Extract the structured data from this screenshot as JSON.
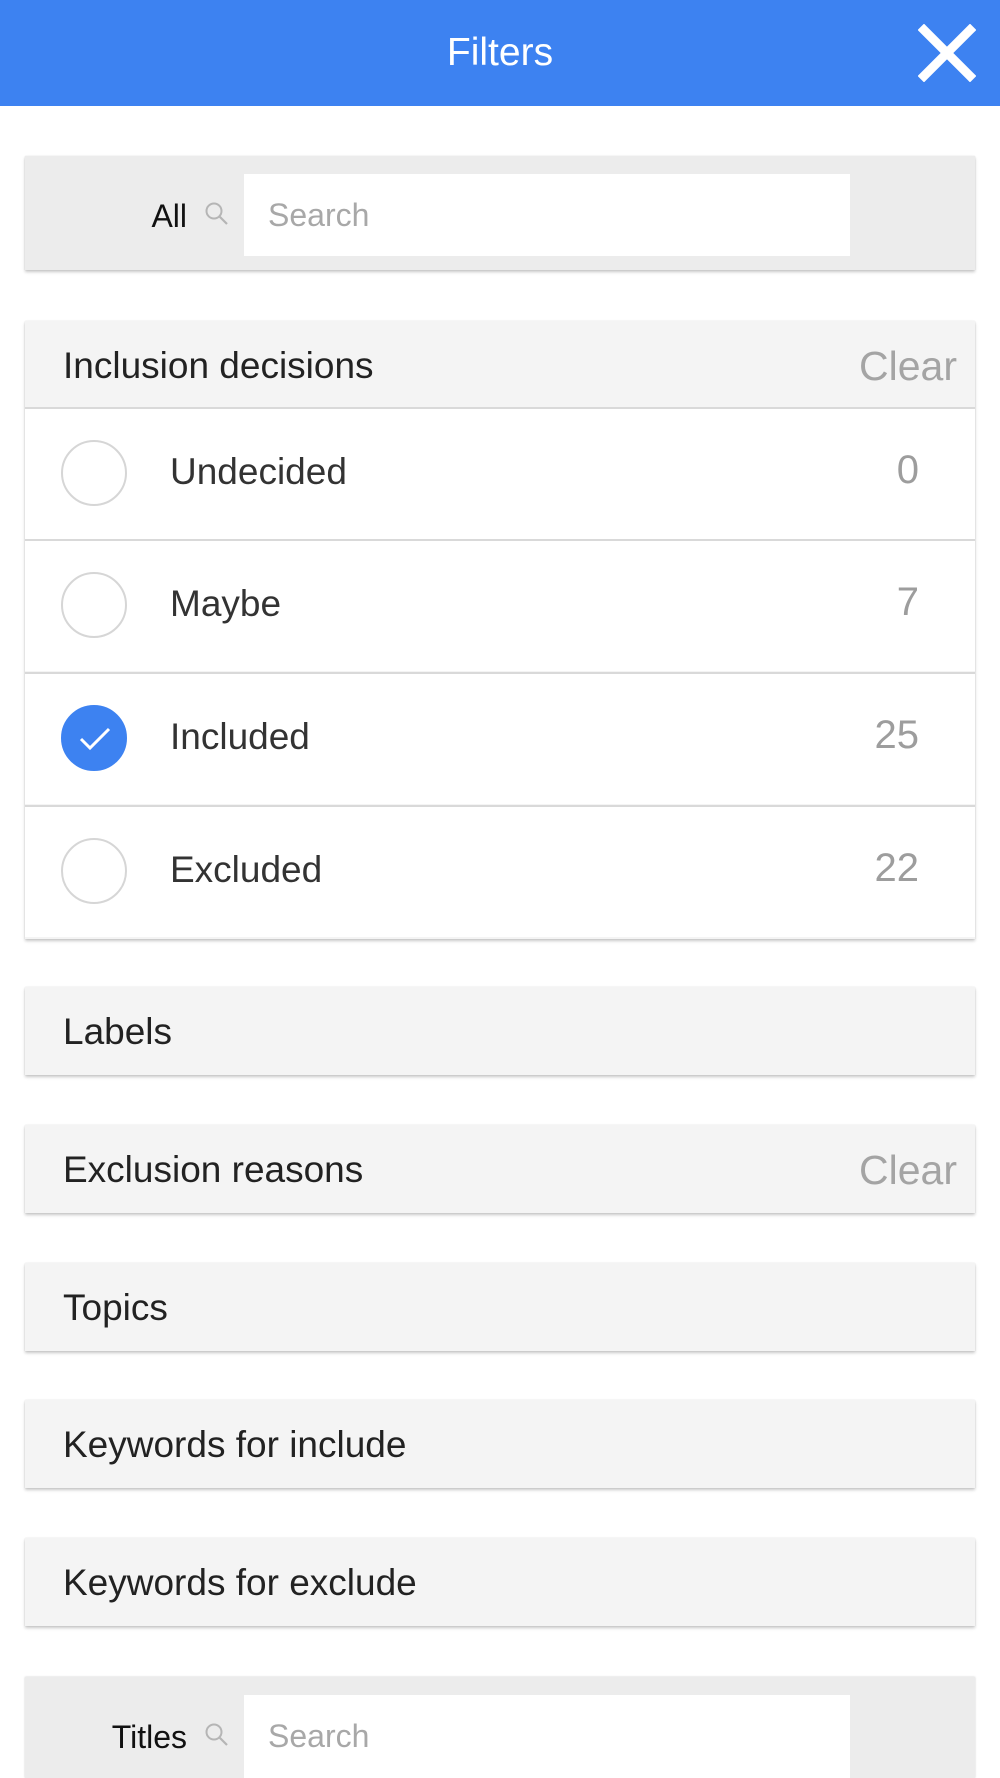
{
  "header": {
    "title": "Filters"
  },
  "all_search": {
    "label": "All",
    "placeholder": "Search"
  },
  "inclusion": {
    "title": "Inclusion decisions",
    "clear": "Clear",
    "options": [
      {
        "label": "Undecided",
        "count": "0",
        "checked": false
      },
      {
        "label": "Maybe",
        "count": "7",
        "checked": false
      },
      {
        "label": "Included",
        "count": "25",
        "checked": true
      },
      {
        "label": "Excluded",
        "count": "22",
        "checked": false
      }
    ]
  },
  "labels": {
    "title": "Labels"
  },
  "exclusion_reasons": {
    "title": "Exclusion reasons",
    "clear": "Clear"
  },
  "topics": {
    "title": "Topics"
  },
  "keywords_include": {
    "title": "Keywords for include"
  },
  "keywords_exclude": {
    "title": "Keywords for exclude"
  },
  "titles_search": {
    "label": "Titles",
    "placeholder": "Search"
  },
  "colors": {
    "accent": "#3d82f1",
    "panel": "#f4f4f4",
    "muted_text": "#a4a4a4"
  }
}
